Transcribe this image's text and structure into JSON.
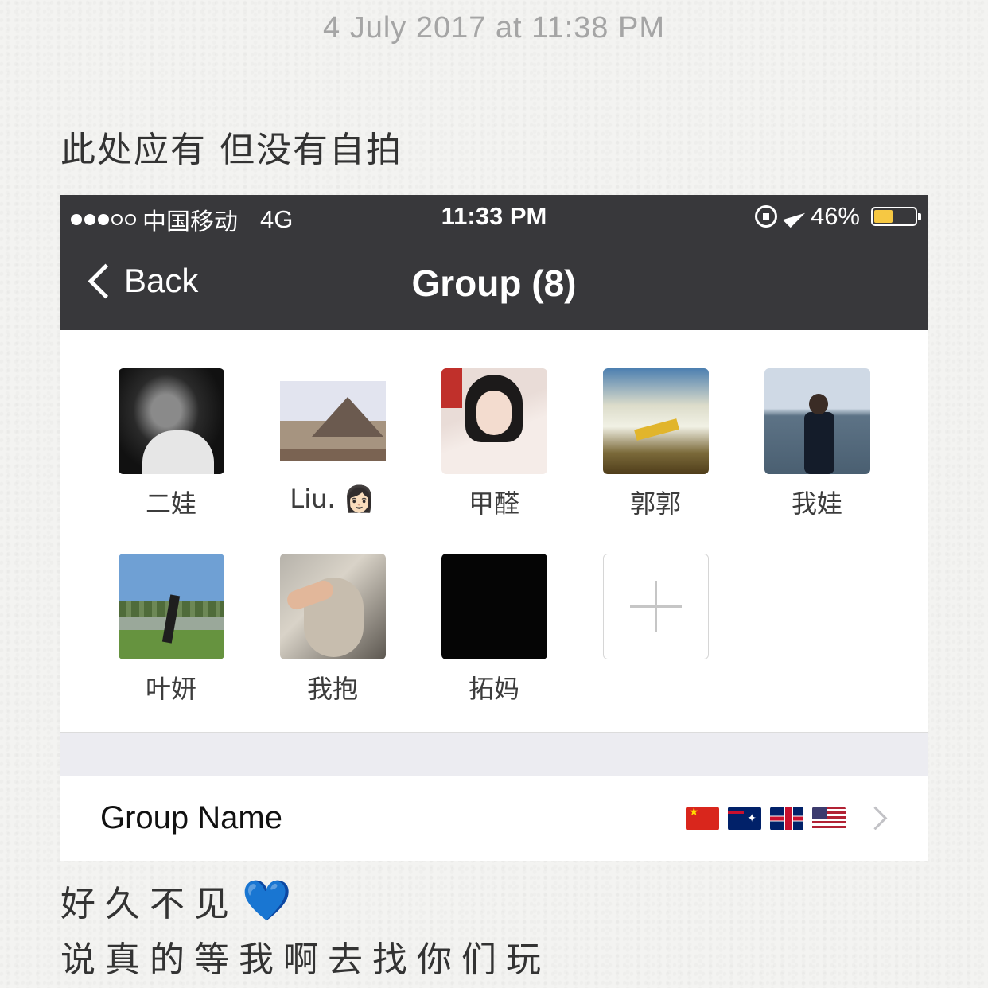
{
  "note": {
    "date": "4 July 2017 at 11:38 PM",
    "line1": "此处应有 但没有自拍",
    "line2": "好久不见",
    "heart_emoji": "💙",
    "line3": "说真的等我啊去找你们玩"
  },
  "status_bar": {
    "signal_dots_filled": 3,
    "signal_dots_total": 5,
    "carrier": "中国移动",
    "network": "4G",
    "time": "11:33 PM",
    "battery_percent": "46%",
    "battery_level": 0.46,
    "icons": [
      "rotation-lock-icon",
      "location-arrow-icon",
      "battery-icon"
    ],
    "battery_color": "#f6c843"
  },
  "nav": {
    "back_label": "Back",
    "title": "Group (8)"
  },
  "members": [
    {
      "name": "二娃"
    },
    {
      "name": "Liu. 👩🏻"
    },
    {
      "name": "甲醛"
    },
    {
      "name": "郭郭"
    },
    {
      "name": "我娃"
    },
    {
      "name": "叶妍"
    },
    {
      "name": "我抱"
    },
    {
      "name": "拓妈"
    }
  ],
  "add_member_icon": "plus-icon",
  "group_name": {
    "label": "Group Name",
    "value_flags": [
      "🇨🇳",
      "🇦🇺",
      "🇬🇧",
      "🇺🇸"
    ]
  },
  "colors": {
    "bar_background": "#38383b",
    "page_background": "#f3f3f1"
  }
}
